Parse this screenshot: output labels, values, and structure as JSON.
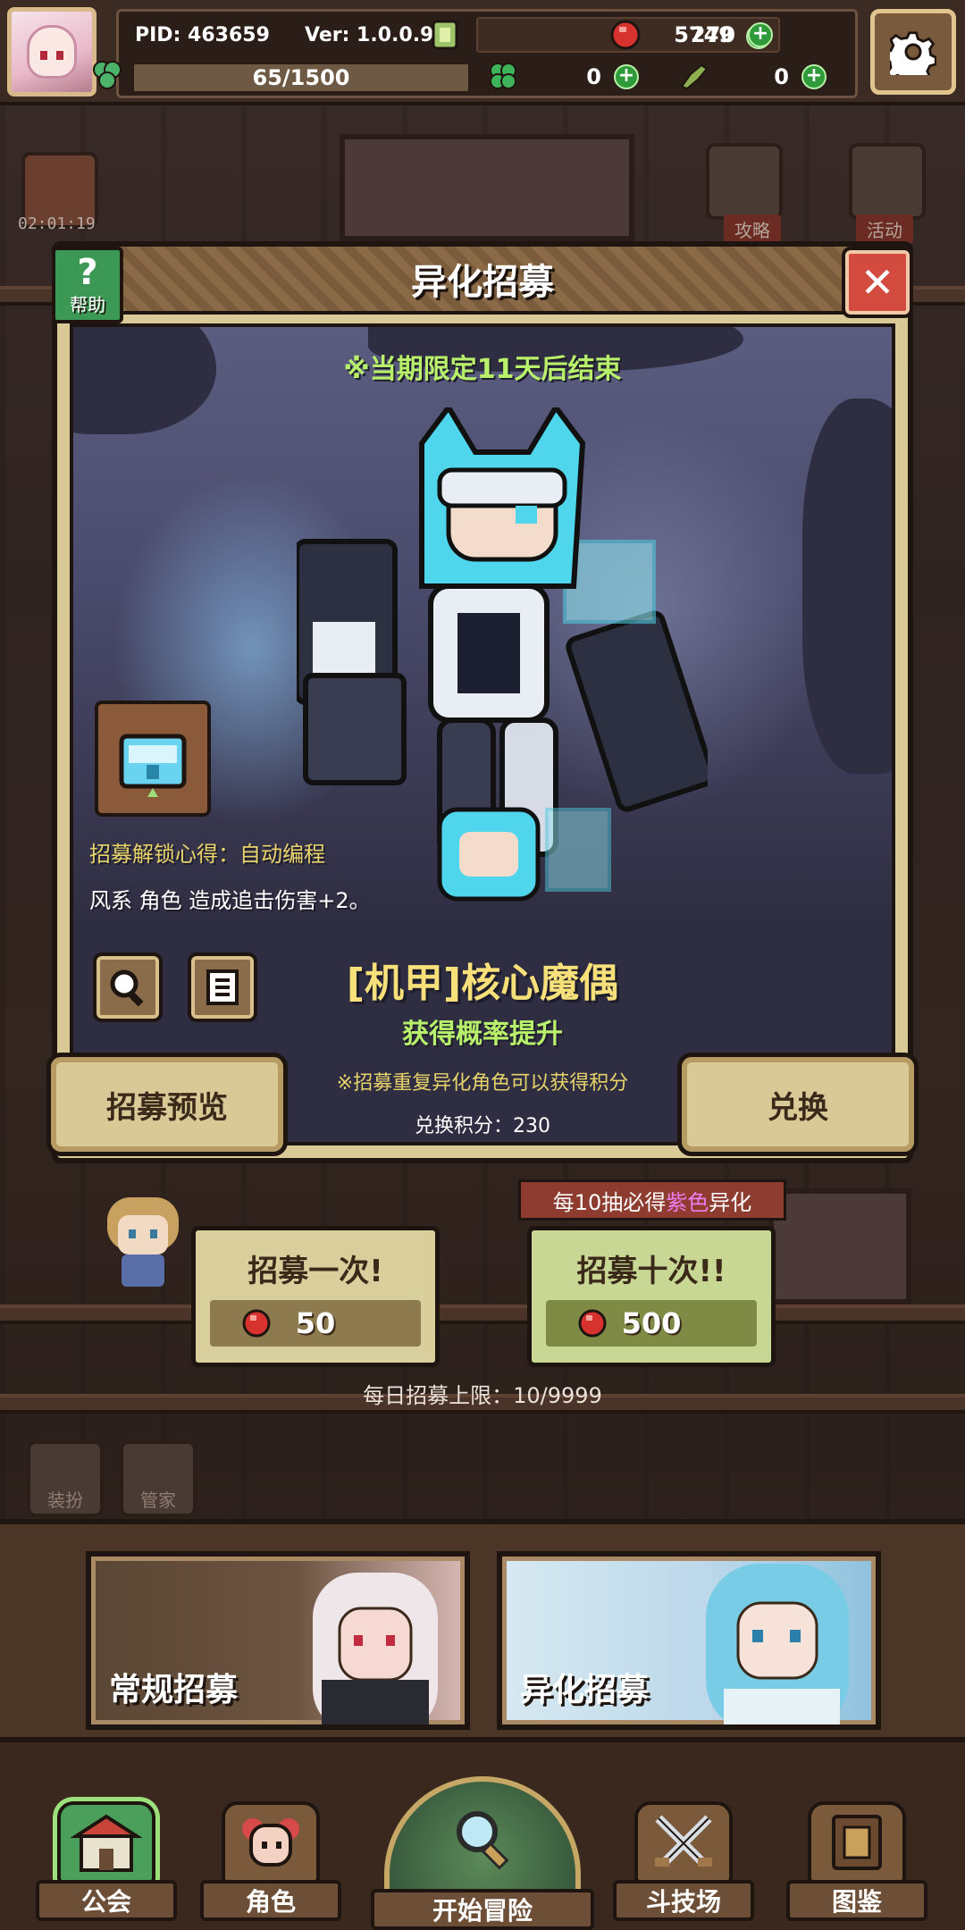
{
  "hud": {
    "pid": "PID: 463659",
    "version": "Ver: 1.0.0.9",
    "coins": "5749",
    "gems": "270",
    "stamina": "65/1500",
    "clover": "0",
    "horn": "0"
  },
  "background": {
    "timer": "02:01:19",
    "tag_strategy": "攻略",
    "tag_event": "活动",
    "btn_dress": "装扮",
    "btn_butler": "管家"
  },
  "popup": {
    "title": "异化招募",
    "help_label": "帮助",
    "close_glyph": "✕",
    "limit_notice": "※当期限定11天后结束",
    "unlock_tip": "招募解锁心得：自动编程",
    "bonus_tip": "风系 角色 造成追击伤害+2。",
    "character_name": "[机甲]核心魔偶",
    "rate_up": "获得概率提升",
    "points_note": "※招募重复异化角色可以获得积分",
    "points_value": "兑换积分：230",
    "preview_button": "招募预览",
    "exchange_button": "兑换"
  },
  "draw": {
    "guarantee_prefix": "每10抽必得",
    "guarantee_highlight": "紫色",
    "guarantee_suffix": "异化",
    "single_label": "招募一次!",
    "single_cost": "50",
    "ten_label": "招募十次!!",
    "ten_cost": "500",
    "daily_limit": "每日招募上限：10/9999"
  },
  "banners": {
    "normal": "常规招募",
    "special": "异化招募"
  },
  "nav": {
    "guild": "公会",
    "character": "角色",
    "adventure": "开始冒险",
    "arena": "斗技场",
    "codex": "图鉴"
  },
  "colors": {
    "accent_green": "#b8f06b",
    "accent_gold": "#f7e07a",
    "gem_red": "#d8322e",
    "purple_highlight": "#ee7cf0"
  },
  "icons": {
    "settings": "gear-icon",
    "coin": "coin-icon",
    "gem": "red-gem-icon",
    "stamina": "clover-icon",
    "horn": "horn-icon",
    "search": "magnifier-icon",
    "list": "list-icon"
  }
}
